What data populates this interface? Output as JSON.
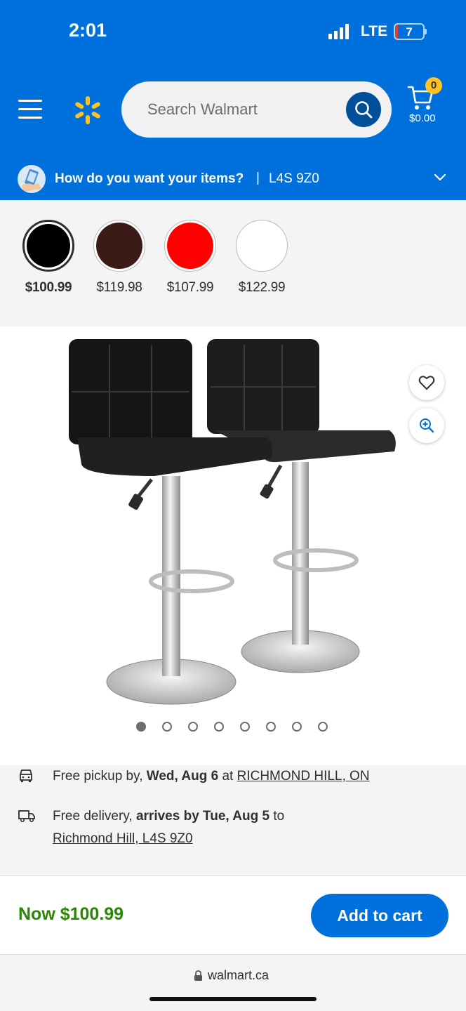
{
  "status_bar": {
    "time": "2:01",
    "network": "LTE",
    "battery": "7"
  },
  "header": {
    "search_placeholder": "Search Walmart",
    "cart_count": "0",
    "cart_total": "$0.00"
  },
  "delivery_bar": {
    "question": "How do you want your items?",
    "separator": "|",
    "postal_code": "L4S 9Z0"
  },
  "swatches": [
    {
      "color": "#000000",
      "price": "$100.99",
      "selected": true
    },
    {
      "color": "#3b1b17",
      "price": "$119.98",
      "selected": false
    },
    {
      "color": "#ff0000",
      "price": "$107.99",
      "selected": false
    },
    {
      "color": "#ffffff",
      "price": "$122.99",
      "selected": false
    }
  ],
  "gallery": {
    "image_count": 8,
    "active_index": 0
  },
  "fulfillment": {
    "pickup": {
      "prefix": "Free pickup by,",
      "date": "Wed, Aug 6",
      "middle": "at",
      "store": "RICHMOND HILL, ON"
    },
    "delivery": {
      "prefix": "Free delivery,",
      "arrives": "arrives by Tue, Aug 5",
      "middle": "to",
      "location": "Richmond Hill, L4S 9Z0"
    }
  },
  "purchase": {
    "now_price": "Now $100.99",
    "add_to_cart_label": "Add to cart"
  },
  "browser": {
    "url": "walmart.ca"
  },
  "colors": {
    "brand_blue": "#0071dc",
    "dark_blue": "#004f9a",
    "spark_yellow": "#ffc220",
    "price_green": "#2a8703"
  }
}
